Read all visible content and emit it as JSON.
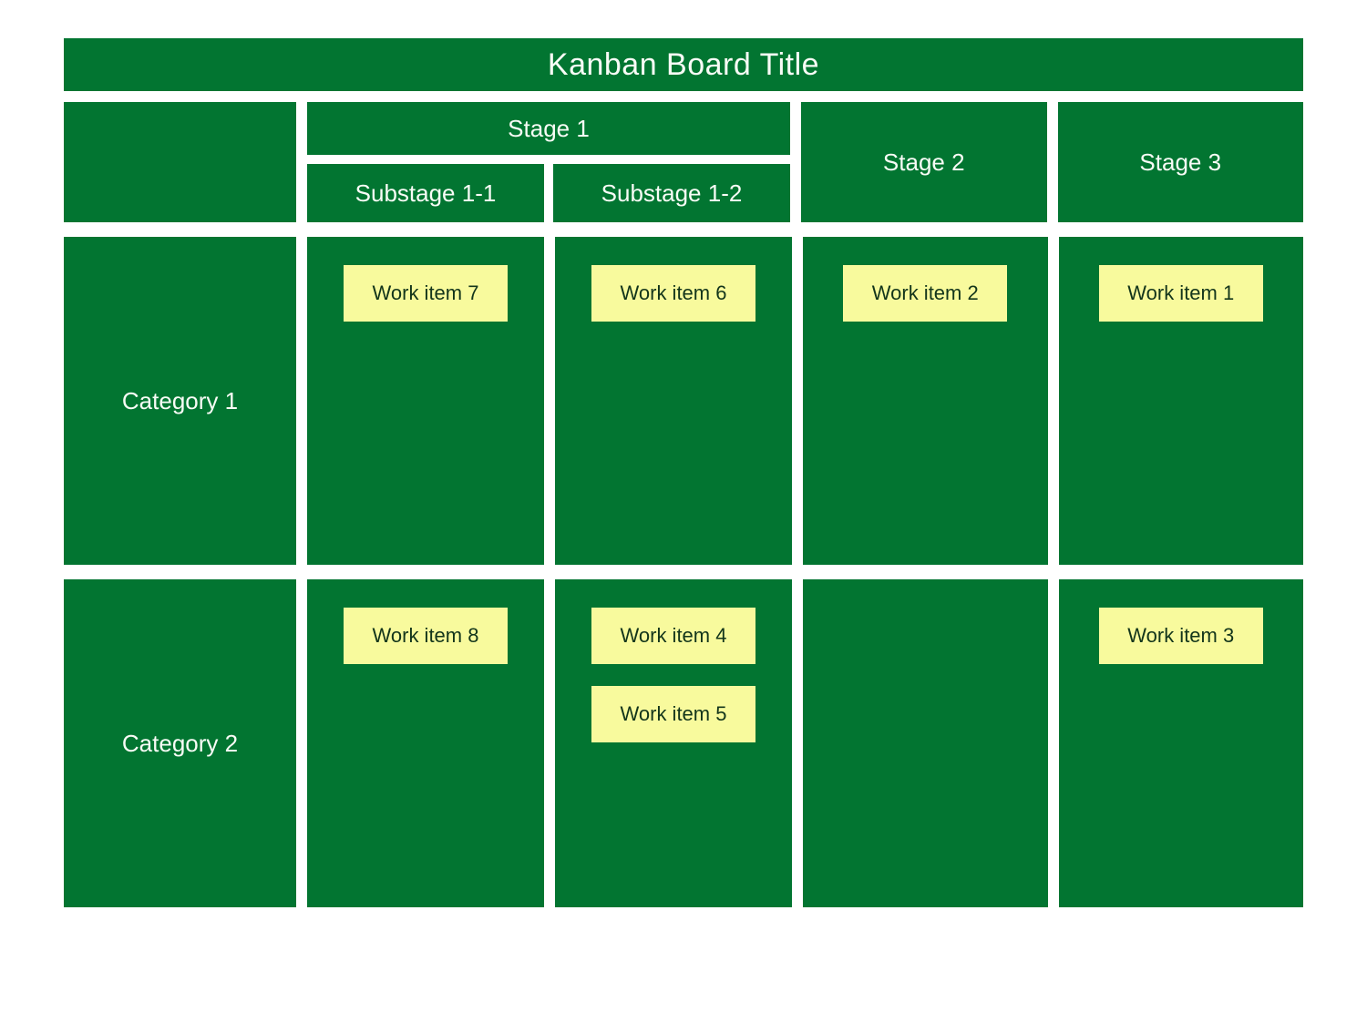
{
  "title": "Kanban Board Title",
  "stages": {
    "stage1": {
      "label": "Stage 1",
      "sub1": "Substage 1-1",
      "sub2": "Substage 1-2"
    },
    "stage2": {
      "label": "Stage 2"
    },
    "stage3": {
      "label": "Stage 3"
    }
  },
  "categories": {
    "cat1": {
      "label": "Category 1"
    },
    "cat2": {
      "label": "Category 2"
    }
  },
  "cards": {
    "cat1": {
      "sub1": [
        "Work item 7"
      ],
      "sub2": [
        "Work item 6"
      ],
      "stage2": [
        "Work item 2"
      ],
      "stage3": [
        "Work item 1"
      ]
    },
    "cat2": {
      "sub1": [
        "Work item 8"
      ],
      "sub2": [
        "Work item 4",
        "Work item 5"
      ],
      "stage2": [],
      "stage3": [
        "Work item 3"
      ]
    }
  },
  "colors": {
    "panel": "#027531",
    "card": "#f8fa9d"
  }
}
